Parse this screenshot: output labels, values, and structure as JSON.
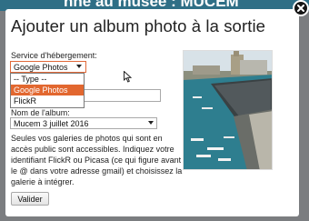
{
  "background": {
    "page_title_fragment": "nne au musee : MUCEM"
  },
  "modal": {
    "title": "Ajouter un album photo à la sortie",
    "hosting_label": "Service d'hébergement:",
    "hosting_select_value": "Google Photos",
    "hosting_options": [
      "-- Type --",
      "Google Photos",
      "FlickR"
    ],
    "hosting_selected_index": 1,
    "album_label": "Nom de l'album:",
    "album_select_value": "Mucem 3 juillet 2016",
    "help_text": "Seules vos galeries de photos qui sont en accès public sont accessibles. Indiquez votre identifiant FlickR ou Picasa (ce qui figure avant le @ dans votre adresse gmail) et choisissez la galerie à intégrer.",
    "validate_label": "Valider"
  },
  "icons": {
    "close": "close-icon",
    "cursor": "mouse-pointer-icon",
    "photo": "album-preview-image"
  },
  "colors": {
    "accent": "#e2672f",
    "header": "#2f6f86",
    "overlay": "#7b7d80"
  }
}
